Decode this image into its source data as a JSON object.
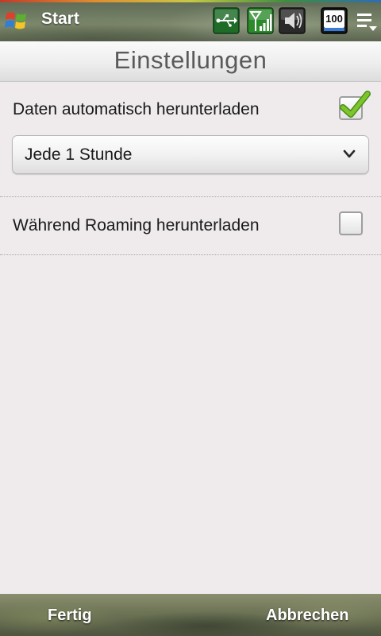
{
  "statusbar": {
    "start_label": "Start",
    "icons": [
      "usb-icon",
      "signal-icon",
      "speaker-icon",
      "battery-icon",
      "menu-icon"
    ],
    "battery_level_text": "100"
  },
  "header": {
    "title": "Einstellungen"
  },
  "settings": {
    "auto_download": {
      "label": "Daten automatisch herunterladen",
      "checked": true
    },
    "interval": {
      "selected": "Jede 1 Stunde"
    },
    "roaming": {
      "label": "Während Roaming herunterladen",
      "checked": false
    }
  },
  "softkeys": {
    "left": "Fertig",
    "right": "Abbrechen"
  },
  "colors": {
    "checkmark": "#6cae22",
    "usb_icon_bg": "#1f6b28",
    "signal_icon_bg": "#2c8a2c",
    "text": "#1a1a1a"
  }
}
